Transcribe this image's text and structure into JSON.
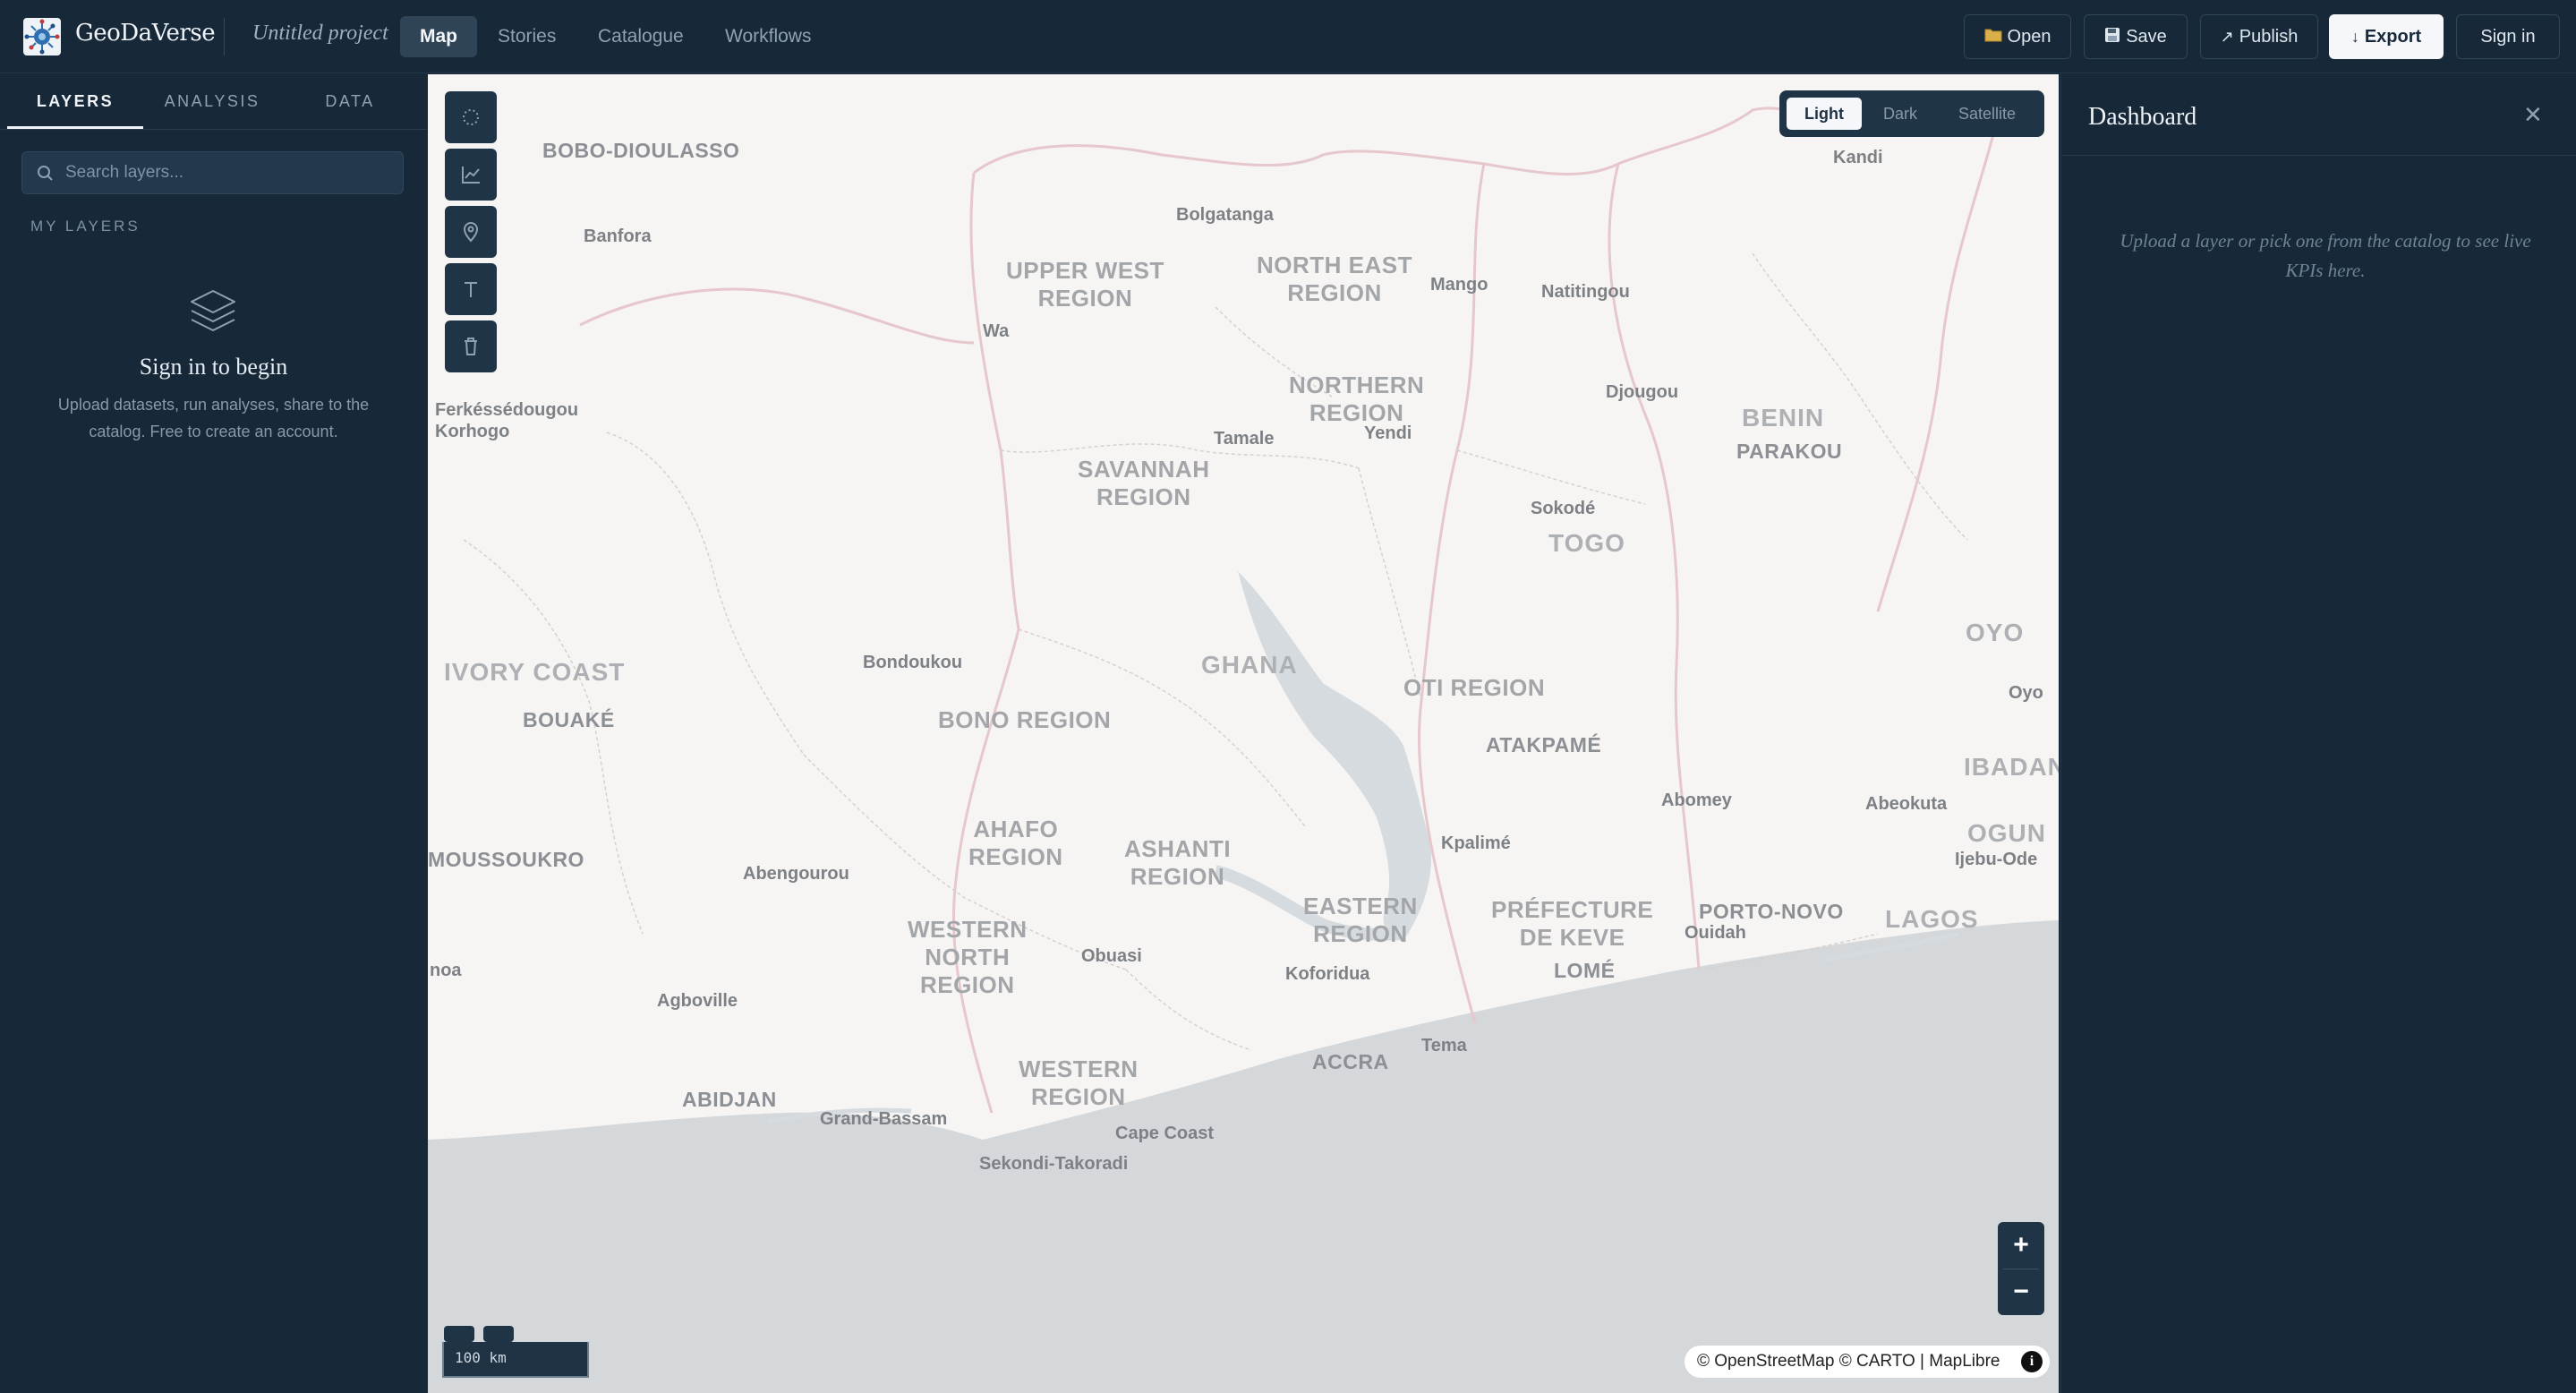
{
  "app": {
    "name": "GeoDaVerse",
    "project_name": "Untitled project",
    "logo_icon": "globe-network-icon"
  },
  "nav": {
    "tabs": [
      {
        "label": "Map",
        "active": true
      },
      {
        "label": "Stories"
      },
      {
        "label": "Catalogue"
      },
      {
        "label": "Workflows"
      }
    ]
  },
  "toolbar": {
    "open_label": "Open",
    "open_icon": "folder-icon",
    "save_label": "Save",
    "save_icon": "floppy-disk-icon",
    "publish_label": "Publish",
    "publish_icon": "arrow-up-right-icon",
    "export_label": "Export",
    "export_icon": "arrow-down-icon",
    "signin_label": "Sign in"
  },
  "sidebar": {
    "tabs": [
      {
        "label": "LAYERS",
        "active": true
      },
      {
        "label": "ANALYSIS"
      },
      {
        "label": "DATA"
      }
    ],
    "search_placeholder": "Search layers...",
    "section_label": "MY LAYERS",
    "empty_title": "Sign in to begin",
    "empty_desc": "Upload datasets, run analyses, share to the catalog. Free to create an account."
  },
  "map": {
    "style_options": [
      {
        "label": "Light",
        "active": true
      },
      {
        "label": "Dark"
      },
      {
        "label": "Satellite"
      }
    ],
    "tools": [
      "lasso-select-icon",
      "chart-line-icon",
      "map-pin-icon",
      "text-icon",
      "trash-icon"
    ],
    "zoom_in": "+",
    "zoom_out": "−",
    "scale_label": "100 km",
    "attribution": "© OpenStreetMap © CARTO | MapLibre",
    "attribution_info": "i",
    "labels": {
      "bobo": "BOBO-DIOULASSO",
      "banfora": "Banfora",
      "bolgatanga": "Bolgatanga",
      "kandi": "Kandi",
      "upper_west": "UPPER WEST\nREGION",
      "north_east": "NORTH EAST\nREGION",
      "mango": "Mango",
      "natitingou": "Natitingou",
      "wa": "Wa",
      "northern": "NORTHERN\nREGION",
      "djougou": "Djougou",
      "benin": "BENIN",
      "parakou": "PARAKOU",
      "ferke": "Ferkéssédougou",
      "korhogo": "Korhogo",
      "tamale": "Tamale",
      "yendi": "Yendi",
      "savannah": "SAVANNAH\nREGION",
      "sokode": "Sokodé",
      "togo": "TOGO",
      "oyo_caps": "OYO",
      "oyo": "Oyo",
      "ivory_coast": "IVORY COAST",
      "bondoukou": "Bondoukou",
      "ghana": "GHANA",
      "oti": "OTI REGION",
      "bouake": "BOUAKÉ",
      "bono": "BONO REGION",
      "atakpame": "ATAKPAMÉ",
      "ibadan": "IBADAN",
      "abomey": "Abomey",
      "abeokuta": "Abeokuta",
      "ogun": "OGUN",
      "ijebu": "Ijebu-Ode",
      "yamoussoukro": "MOUSSOUKRO",
      "abengourou": "Abengourou",
      "ahafo": "AHAFO\nREGION",
      "ashanti": "ASHANTI\nREGION",
      "kpalime": "Kpalimé",
      "eastern": "EASTERN\nREGION",
      "prefecture": "PRÉFECTURE\nDE KEVE",
      "porto_novo": "PORTO-NOVO",
      "ouidah": "Ouidah",
      "lagos": "LAGOS",
      "western_north": "WESTERN\nNORTH\nREGION",
      "obuasi": "Obuasi",
      "koforidua": "Koforidua",
      "lome": "LOMÉ",
      "noa": "noa",
      "agboville": "Agboville",
      "tema": "Tema",
      "accra": "ACCRA",
      "western": "WESTERN\nREGION",
      "abidjan": "ABIDJAN",
      "grand_bassam": "Grand-Bassam",
      "cape_coast": "Cape Coast",
      "sekondi": "Sekondi-Takoradi"
    }
  },
  "dashboard": {
    "title": "Dashboard",
    "close_icon": "close-icon",
    "hint": "Upload a layer or pick one from the catalog to see live KPIs here."
  }
}
